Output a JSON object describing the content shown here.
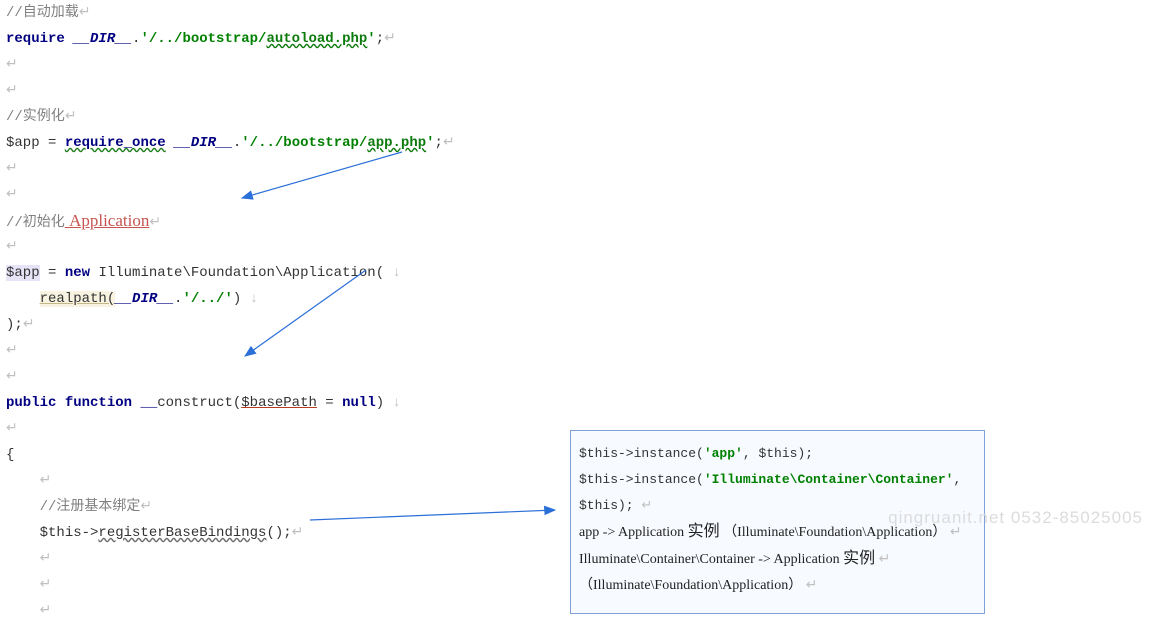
{
  "lines": {
    "l1_comment": "//自动加载",
    "l2_require": "require",
    "l2_dir": "__DIR__",
    "l2_dot": ".",
    "l2_q1": "'/../bootstrap/",
    "l2_file": "autoload.php",
    "l2_q2": "'",
    "l2_end": ";",
    "l5_comment": "//实例化",
    "l6_var": "$app",
    "l6_eq": " = ",
    "l6_req": "require_once",
    "l6_dir": " __DIR__",
    "l6_dot": ".",
    "l6_q1": "'/../bootstrap/",
    "l6_file": "app.php",
    "l6_q2": "'",
    "l6_end": ";",
    "l9_comment": "//初始化",
    "l9_app": " Application",
    "l11_var": "$app",
    "l11_eq": " = ",
    "l11_new": "new",
    "l11_cls": " Illuminate\\Foundation\\Application(",
    "l12_indent": "    ",
    "l12_real": "realpath(",
    "l12_dir": "__DIR__",
    "l12_dot": ".",
    "l12_str": "'/../'",
    "l12_close": ")",
    "l13_close": ");",
    "l16_public": "public",
    "l16_func": " function ",
    "l16_dunder": "__",
    "l16_name": "construct(",
    "l16_param": "$basePath",
    "l16_eq": " = ",
    "l16_null": "null",
    "l16_close": ")",
    "l18_brace": "{",
    "l19_indent": "    ",
    "l20_indent": "    ",
    "l20_comment": "//注册基本绑定",
    "l21_indent": "    ",
    "l21_this": "$this->",
    "l21_call": "registerBaseBindings",
    "l21_paren": "();"
  },
  "tooltip": {
    "r1_this": "$this->instance(",
    "r1_arg1": "'app'",
    "r1_mid": ", $this);",
    "r2_this": "$this->instance(",
    "r2_arg1": "'Illuminate\\Container\\Container'",
    "r2_mid": ", $this);",
    "r3_a": "app -> Application ",
    "r3_b": "实例",
    "r3_c": " （Illuminate\\Foundation\\Application）",
    "r4_a": "Illuminate\\Container\\Container -> Application ",
    "r4_b": "实例",
    "r5_a": "（Illuminate\\Foundation\\Application）"
  },
  "ret": "↵",
  "down": "↓",
  "watermark": "qingruanit.net 0532-85025005"
}
